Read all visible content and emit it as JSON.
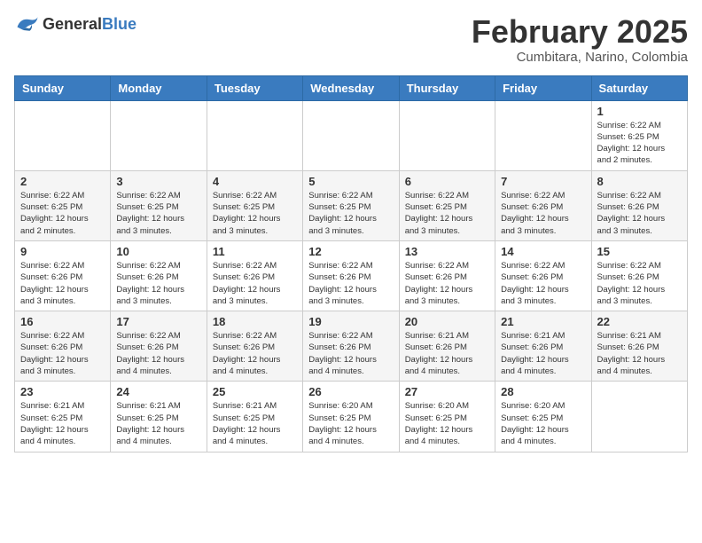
{
  "logo": {
    "text_general": "General",
    "text_blue": "Blue"
  },
  "header": {
    "title": "February 2025",
    "subtitle": "Cumbitara, Narino, Colombia"
  },
  "weekdays": [
    "Sunday",
    "Monday",
    "Tuesday",
    "Wednesday",
    "Thursday",
    "Friday",
    "Saturday"
  ],
  "weeks": [
    [
      {
        "day": "",
        "info": ""
      },
      {
        "day": "",
        "info": ""
      },
      {
        "day": "",
        "info": ""
      },
      {
        "day": "",
        "info": ""
      },
      {
        "day": "",
        "info": ""
      },
      {
        "day": "",
        "info": ""
      },
      {
        "day": "1",
        "info": "Sunrise: 6:22 AM\nSunset: 6:25 PM\nDaylight: 12 hours\nand 2 minutes."
      }
    ],
    [
      {
        "day": "2",
        "info": "Sunrise: 6:22 AM\nSunset: 6:25 PM\nDaylight: 12 hours\nand 2 minutes."
      },
      {
        "day": "3",
        "info": "Sunrise: 6:22 AM\nSunset: 6:25 PM\nDaylight: 12 hours\nand 3 minutes."
      },
      {
        "day": "4",
        "info": "Sunrise: 6:22 AM\nSunset: 6:25 PM\nDaylight: 12 hours\nand 3 minutes."
      },
      {
        "day": "5",
        "info": "Sunrise: 6:22 AM\nSunset: 6:25 PM\nDaylight: 12 hours\nand 3 minutes."
      },
      {
        "day": "6",
        "info": "Sunrise: 6:22 AM\nSunset: 6:25 PM\nDaylight: 12 hours\nand 3 minutes."
      },
      {
        "day": "7",
        "info": "Sunrise: 6:22 AM\nSunset: 6:26 PM\nDaylight: 12 hours\nand 3 minutes."
      },
      {
        "day": "8",
        "info": "Sunrise: 6:22 AM\nSunset: 6:26 PM\nDaylight: 12 hours\nand 3 minutes."
      }
    ],
    [
      {
        "day": "9",
        "info": "Sunrise: 6:22 AM\nSunset: 6:26 PM\nDaylight: 12 hours\nand 3 minutes."
      },
      {
        "day": "10",
        "info": "Sunrise: 6:22 AM\nSunset: 6:26 PM\nDaylight: 12 hours\nand 3 minutes."
      },
      {
        "day": "11",
        "info": "Sunrise: 6:22 AM\nSunset: 6:26 PM\nDaylight: 12 hours\nand 3 minutes."
      },
      {
        "day": "12",
        "info": "Sunrise: 6:22 AM\nSunset: 6:26 PM\nDaylight: 12 hours\nand 3 minutes."
      },
      {
        "day": "13",
        "info": "Sunrise: 6:22 AM\nSunset: 6:26 PM\nDaylight: 12 hours\nand 3 minutes."
      },
      {
        "day": "14",
        "info": "Sunrise: 6:22 AM\nSunset: 6:26 PM\nDaylight: 12 hours\nand 3 minutes."
      },
      {
        "day": "15",
        "info": "Sunrise: 6:22 AM\nSunset: 6:26 PM\nDaylight: 12 hours\nand 3 minutes."
      }
    ],
    [
      {
        "day": "16",
        "info": "Sunrise: 6:22 AM\nSunset: 6:26 PM\nDaylight: 12 hours\nand 3 minutes."
      },
      {
        "day": "17",
        "info": "Sunrise: 6:22 AM\nSunset: 6:26 PM\nDaylight: 12 hours\nand 4 minutes."
      },
      {
        "day": "18",
        "info": "Sunrise: 6:22 AM\nSunset: 6:26 PM\nDaylight: 12 hours\nand 4 minutes."
      },
      {
        "day": "19",
        "info": "Sunrise: 6:22 AM\nSunset: 6:26 PM\nDaylight: 12 hours\nand 4 minutes."
      },
      {
        "day": "20",
        "info": "Sunrise: 6:21 AM\nSunset: 6:26 PM\nDaylight: 12 hours\nand 4 minutes."
      },
      {
        "day": "21",
        "info": "Sunrise: 6:21 AM\nSunset: 6:26 PM\nDaylight: 12 hours\nand 4 minutes."
      },
      {
        "day": "22",
        "info": "Sunrise: 6:21 AM\nSunset: 6:26 PM\nDaylight: 12 hours\nand 4 minutes."
      }
    ],
    [
      {
        "day": "23",
        "info": "Sunrise: 6:21 AM\nSunset: 6:25 PM\nDaylight: 12 hours\nand 4 minutes."
      },
      {
        "day": "24",
        "info": "Sunrise: 6:21 AM\nSunset: 6:25 PM\nDaylight: 12 hours\nand 4 minutes."
      },
      {
        "day": "25",
        "info": "Sunrise: 6:21 AM\nSunset: 6:25 PM\nDaylight: 12 hours\nand 4 minutes."
      },
      {
        "day": "26",
        "info": "Sunrise: 6:20 AM\nSunset: 6:25 PM\nDaylight: 12 hours\nand 4 minutes."
      },
      {
        "day": "27",
        "info": "Sunrise: 6:20 AM\nSunset: 6:25 PM\nDaylight: 12 hours\nand 4 minutes."
      },
      {
        "day": "28",
        "info": "Sunrise: 6:20 AM\nSunset: 6:25 PM\nDaylight: 12 hours\nand 4 minutes."
      },
      {
        "day": "",
        "info": ""
      }
    ]
  ]
}
